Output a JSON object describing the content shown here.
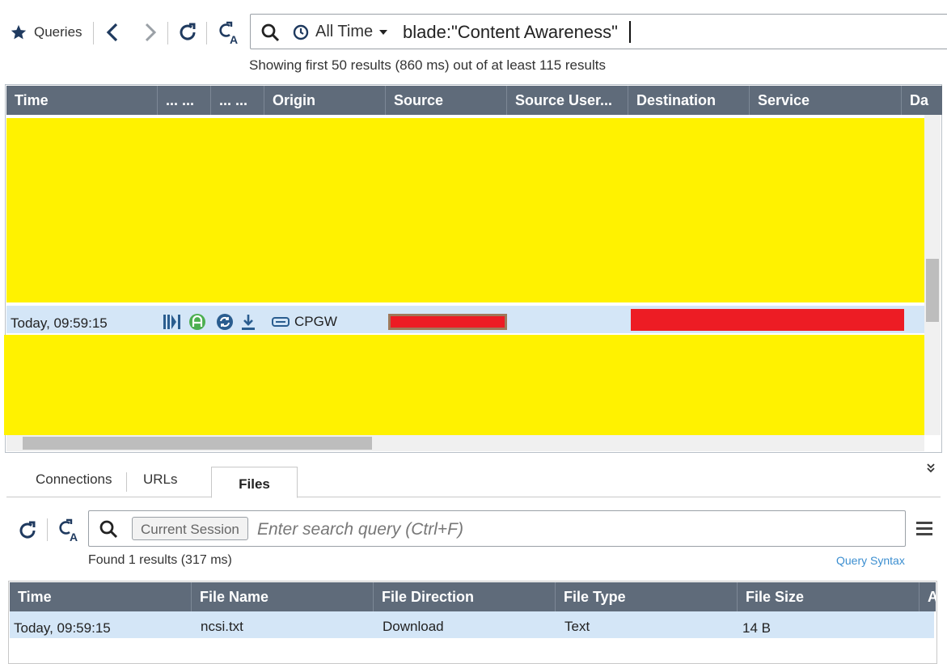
{
  "toolbar": {
    "queries_label": "Queries",
    "star_icon": "star-icon",
    "back_icon": "chevron-left-icon",
    "forward_icon": "chevron-right-icon",
    "refresh_icon": "refresh-icon",
    "query_options_icon": "query-options-icon"
  },
  "search": {
    "time_filter": "All Time",
    "query": "blade:\"Content Awareness\""
  },
  "status_text": "Showing first 50 results (860 ms) out of at least 115 results",
  "grid": {
    "columns": [
      "Time",
      "... ...",
      "... ...",
      "Origin",
      "Source",
      "Source User...",
      "Destination",
      "Service",
      "Da"
    ],
    "selected_row": {
      "time": "Today, 09:59:15",
      "origin": "CPGW"
    }
  },
  "details": {
    "tabs": [
      "Connections",
      "URLs",
      "Files"
    ],
    "active_tab": "Files",
    "session_chip": "Current Session",
    "search_placeholder": "Enter search query (Ctrl+F)",
    "found_text": "Found 1 results (317 ms)",
    "query_syntax": "Query Syntax",
    "columns": [
      "Time",
      "File Name",
      "File Direction",
      "File Type",
      "File Size",
      "A"
    ],
    "rows": [
      {
        "time": "Today, 09:59:15",
        "file_name": "ncsi.txt",
        "direction": "Download",
        "type": "Text",
        "size": "14 B"
      }
    ]
  },
  "colors": {
    "header_bg": "#5f6b7a",
    "selected_row": "#d4e6f7",
    "redaction_yellow": "#fff200",
    "redaction_red": "#ed1c24",
    "link": "#3b8ed0"
  }
}
